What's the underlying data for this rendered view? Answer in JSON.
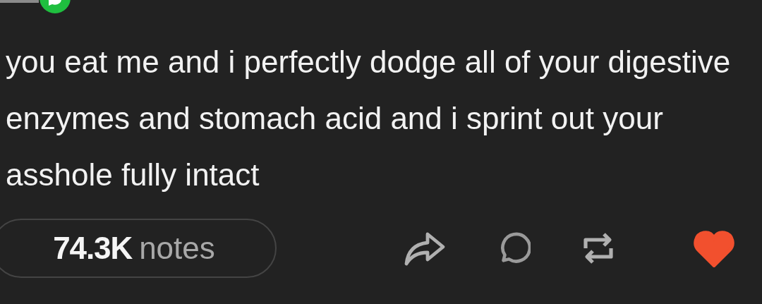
{
  "post": {
    "body": "you eat me and i perfectly dodge all of your digestive enzymes and stomach acid and i sprint out your asshole fully intact"
  },
  "footer": {
    "notes_count": "74.3K",
    "notes_label": "notes",
    "liked": true
  }
}
